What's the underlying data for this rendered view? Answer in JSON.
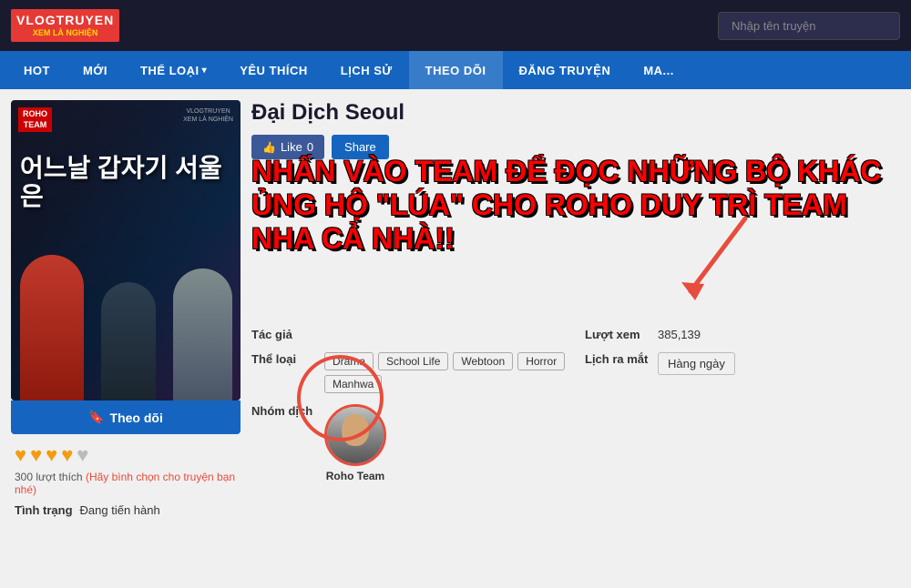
{
  "header": {
    "logo": {
      "main": "VLOGTRUYEN",
      "sub": "XEM LÀ NGHIỆN"
    },
    "search_placeholder": "Nhập tên truyện"
  },
  "nav": {
    "items": [
      {
        "label": "HOT",
        "has_arrow": false
      },
      {
        "label": "MỚI",
        "has_arrow": false
      },
      {
        "label": "THỂ LOẠI",
        "has_arrow": true
      },
      {
        "label": "YÊU THÍCH",
        "has_arrow": false
      },
      {
        "label": "LỊCH SỬ",
        "has_arrow": false
      },
      {
        "label": "THEO DÕI",
        "has_arrow": false
      },
      {
        "label": "ĐĂNG TRUYỆN",
        "has_arrow": false
      },
      {
        "label": "MA...",
        "has_arrow": false
      }
    ]
  },
  "manga": {
    "title": "Đại Dịch Seoul",
    "cover_title_korean": "어느날 갑자기 서울은",
    "cover_badge_line1": "ROHO",
    "cover_badge_line2": "TEAM",
    "watermark_line1": "VLOGTRUYEN",
    "watermark_line2": "XEM LÀ NGHIỆN",
    "like_count": "0",
    "like_label": "Like",
    "share_label": "Share",
    "promo_text": "NHẤN VÀO TEAM ĐỂ ĐỌC NHỮNG BỘ KHÁC ỦNG HỘ \"LÚA\" CHO ROHO DUY TRÌ TEAM NHA CẢ NHÀ!!",
    "author_label": "Tác giả",
    "author_value": "",
    "genre_label": "Thể loại",
    "genres": [
      "Drama",
      "School Life",
      "Webtoon",
      "Horror",
      "Manhwa"
    ],
    "translator_label": "Nhóm dịch",
    "translator_name": "Roho Team",
    "views_label": "Lượt xem",
    "views_value": "385,139",
    "release_label": "Lịch ra mắt",
    "release_value": "Hàng ngày",
    "status_label": "Tình trạng",
    "status_value": "Đang tiến hành",
    "follow_label": "Theo dõi",
    "stars_filled": 4,
    "stars_total": 5,
    "rating_count": "300 lượt thích",
    "rating_prompt": "(Hãy bình chọn cho truyện bạn nhé)"
  }
}
